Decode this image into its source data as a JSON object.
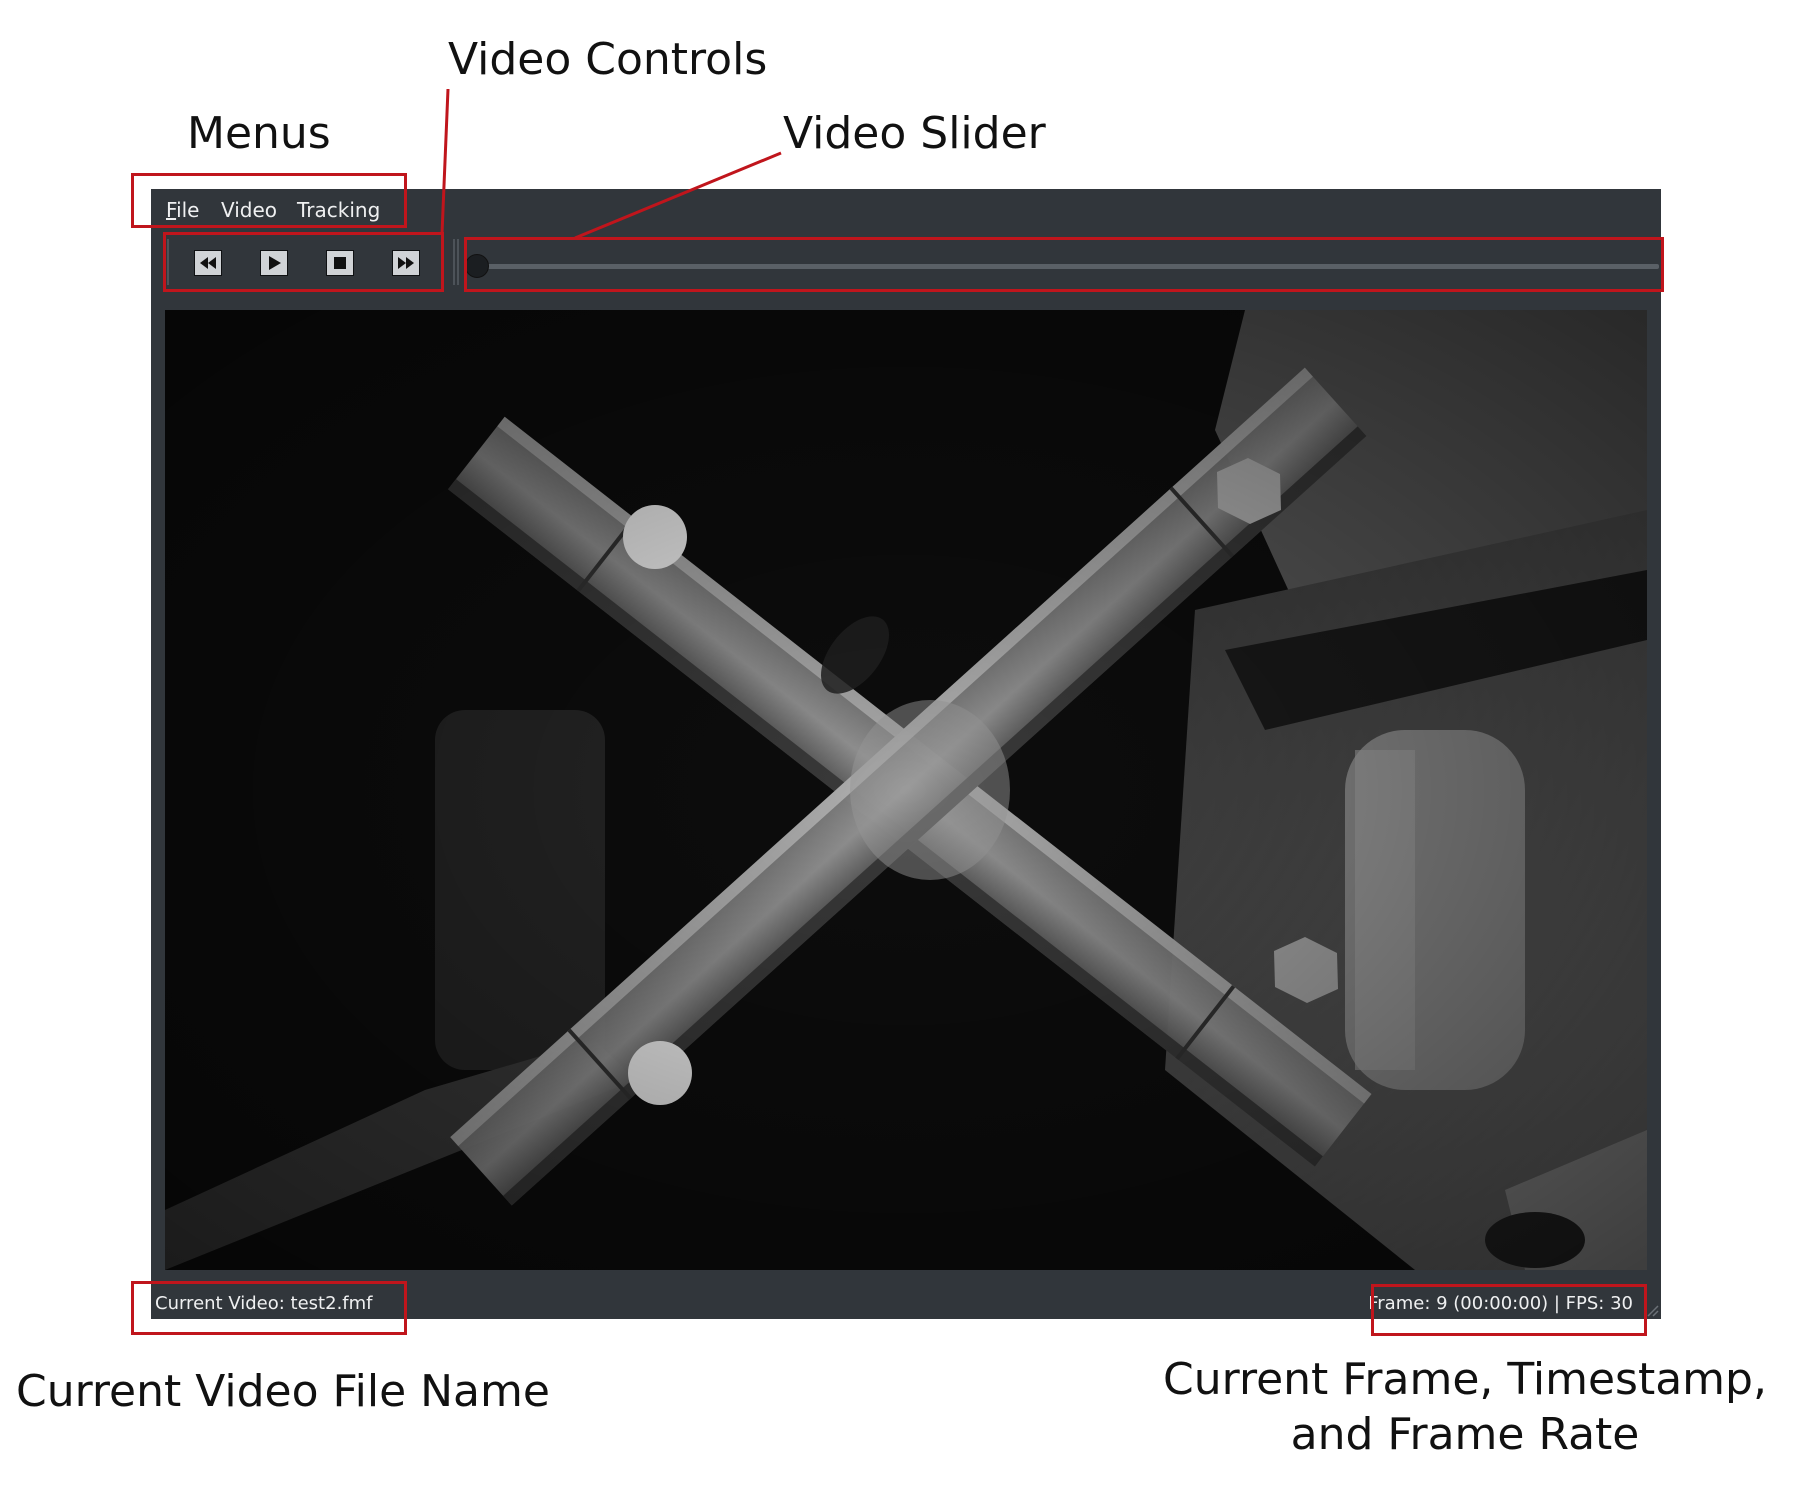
{
  "annotations": {
    "menus": "Menus",
    "video_controls": "Video Controls",
    "video_slider": "Video Slider",
    "current_file": "Current Video File Name",
    "frame_info": "Current Frame, Timestamp, and Frame Rate"
  },
  "menubar": {
    "items": [
      {
        "label": "File",
        "mnemonic": "F"
      },
      {
        "label": "Video"
      },
      {
        "label": "Tracking"
      }
    ]
  },
  "controls": {
    "icons": [
      "rewind-icon",
      "play-icon",
      "stop-icon",
      "fast-forward-icon"
    ]
  },
  "slider": {
    "position_fraction": 0.0
  },
  "status": {
    "current_video": "Current Video: test2.fmf",
    "frame_info": "Frame: 9 (00:00:00) | FPS: 30"
  },
  "colors": {
    "window_bg": "#31363b",
    "annotation_red": "#c0151c",
    "text": "#eff0f1"
  }
}
